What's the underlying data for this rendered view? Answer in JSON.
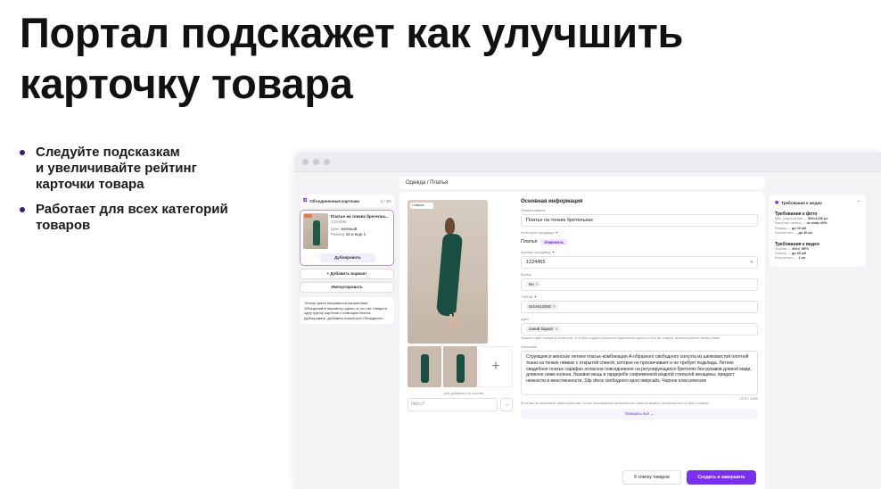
{
  "slide": {
    "title": "Портал подскажет как улучшить карточку товара",
    "bullets": [
      "Следуйте подсказкам\nи увеличивайте рейтинг\nкарточки товара",
      "Работает для всех категорий товаров"
    ]
  },
  "app": {
    "breadcrumb": "Одежда / Платья",
    "left_panel": {
      "header": "Объединенные карточки",
      "count": "1 / 30",
      "card": {
        "name": "Платье на тонких бретельк...",
        "article": "1224455",
        "color_label": "Цвет",
        "color_value": "зеленый",
        "size_label": "Размер",
        "size_value": "42 и еще 1"
      },
      "duplicate_label": "Дублировать",
      "add_variant_label": "Добавить вариант",
      "import_label": "Импортировать",
      "note": "Теперь цвета называются вариантами. Объединяйте варианты одного в того же товара в одну группу карточек с помощью кнопок Дублировать, Добавить новый или Объединить."
    },
    "media": {
      "main_badge": "Главное",
      "url_hint": "или добавить по ссылке",
      "url_placeholder": "https://"
    },
    "form": {
      "title": "Основная информация",
      "name_label": "Наименование",
      "name_value": "Платье на тонких бретельках",
      "category_label": "Категория продавца",
      "category_value": "Платья",
      "change_label": "Изменить",
      "article_label": "Артикул продавца",
      "article_value": "1224455",
      "brand_label": "Бренд",
      "brand_value": "No",
      "tnved_label": "ТНВЭД",
      "tnved_value": "6104410000",
      "color_label": "Цвет",
      "color_value": "синий бархат",
      "color_hint": "Укажите цвет товара в этом поле, а чтобы создать несколько вариантов одного и того же товара, воспользуйтесь меню слева.",
      "description_label": "Описание",
      "description_text": "Струящееся женское летнее платье-комбинация А-образного свободного силуэта из шелковистой плотной ткани на тонких лямках с открытой спиной, которое не просвечивает и не требует подклада. Летнее свадебное платье сарафан атласное повседневное на регулирующихся бретелях без рукавов длиной миди, длинное ниже колена, базовая вещь в гардеробе современной модной стильной женщины, придаст нежности и женственности. Slip dress свободного кроя оверсайз. Черное классическое",
      "counter": "1376 / 2000",
      "autofill_hint": "Если вы не заполните характеристики, то мы постараемся заполнить их сами из вашего описания или по фото товара.",
      "show_all_label": "Показать все"
    },
    "footer": {
      "back_label": "К списку товаров",
      "create_label": "Создать и завершить"
    },
    "requirements": {
      "header": "Требования к медиа",
      "photo_title": "Требования к фото",
      "photo_lines": [
        {
          "k": "Мин. разрешение",
          "v": "900х1200 px"
        },
        {
          "k": "Качество сжатия",
          "v": "не ниже 85%"
        },
        {
          "k": "Размер",
          "v": "до 10 мб"
        },
        {
          "k": "Количество",
          "v": "до 30 шт"
        }
      ],
      "video_title": "Требования к видео",
      "video_lines": [
        {
          "k": "Формат",
          "v": "MOV, MP4"
        },
        {
          "k": "Размер",
          "v": "до 50 мб"
        },
        {
          "k": "Количество",
          "v": "1 шт"
        }
      ]
    }
  }
}
